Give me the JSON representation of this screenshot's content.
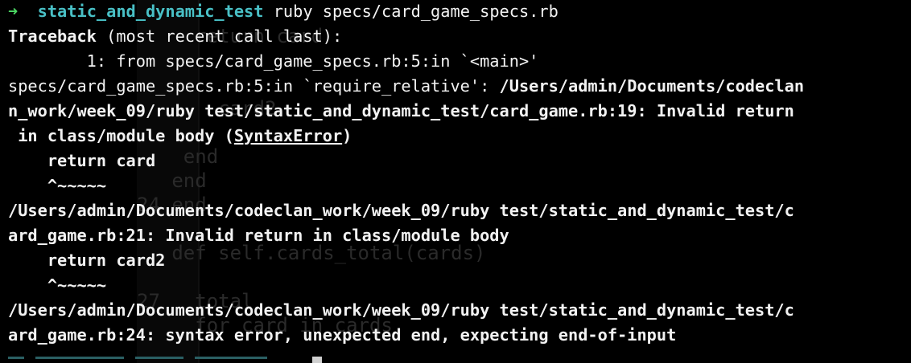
{
  "window": {
    "prompt_symbol": "➜",
    "prompt_directory": "static_and_dynamic_test",
    "command": " ruby specs/card_game_specs.rb"
  },
  "output": {
    "traceback_bold": "Traceback",
    "traceback_rest": " (most recent call last):",
    "frame_1": "        1: from specs/card_game_specs.rb:5:in `<main>'",
    "error_prefix": "specs/card_game_specs.rb:5:in `require_relative': ",
    "error_path_1": "/Users/admin/Documents/codeclan",
    "error_path_2": "n_work/week_09/ruby test/static_and_dynamic_test/card_game.rb:19: Invalid return",
    "error_path_3_pre": " in class/module body (",
    "error_type": "SyntaxError",
    "error_path_3_post": ")",
    "src_line_1": "    return card",
    "caret_1": "    ^~~~~~",
    "error2_line_1": "/Users/admin/Documents/codeclan_work/week_09/ruby test/static_and_dynamic_test/c",
    "error2_line_2": "ard_game.rb:21: Invalid return in class/module body",
    "src_line_2": "    return card2",
    "caret_2": "    ^~~~~~",
    "error3_line_1": "/Users/admin/Documents/codeclan_work/week_09/ruby test/static_and_dynamic_test/c",
    "error3_line_2": "ard_game.rb:24: syntax error, unexpected end, expecting end-of-input"
  },
  "background_editor": {
    "lines": [
      "",
      "     return card",
      "",
      "",
      "       card2",
      "",
      "    end",
      "   end",
      "24 end",
      "",
      "   def self.cards_total(cards)",
      "",
      "27   total",
      "     for card in cards",
      ""
    ]
  }
}
